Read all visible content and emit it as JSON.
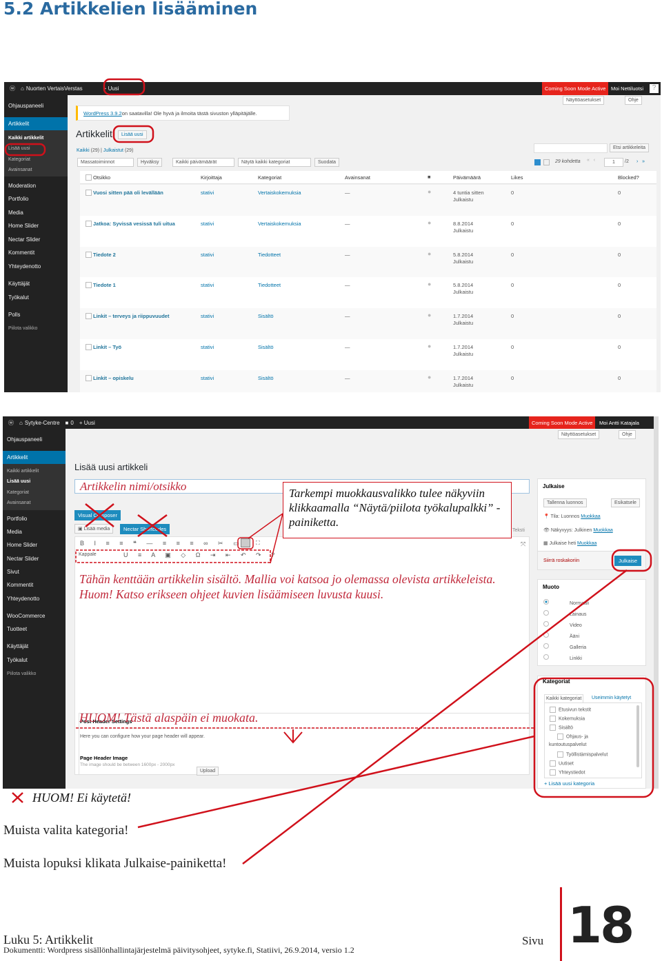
{
  "heading": "5.2 Artikkelien lisääminen",
  "shot1": {
    "adminbar": {
      "site": "Nuorten VertaisVerstas",
      "new": "Uusi",
      "coming_soon": "Coming Soon Mode Active",
      "greeting": "Moi Nettiluotsi",
      "help_icon": "?"
    },
    "screen_options": "Näyttöasetukset",
    "help": "Ohje",
    "sidebar": {
      "dashboard": "Ohjauspaneeli",
      "posts": "Artikkelit",
      "all_posts": "Kaikki artikkelit",
      "add_new": "Lisää uusi",
      "categories": "Kategoriat",
      "tags": "Avainsanat",
      "items": [
        "Moderation",
        "Portfolio",
        "Media",
        "Home Slider",
        "Nectar Slider",
        "Kommentit",
        "Yhteydenotto",
        "Käyttäjät",
        "Työkalut",
        "Polls",
        "Piilota valikko"
      ]
    },
    "notice_link": "WordPress 3.9.2",
    "notice_text": "on saatavilla! Ole hyvä ja ilmoita tästä sivuston ylläpitäjälle.",
    "page_title": "Artikkelit",
    "add_new_button": "Lisää uusi",
    "filters_all": "Kaikki",
    "filters_all_count": "(29)",
    "filters_published": "Julkaistut",
    "filters_published_count": "(29)",
    "bulk": "Massatoiminnot",
    "apply": "Hyväksy",
    "dates": "Kaikki päivämäärät",
    "cats": "Näytä kaikki kategoriat",
    "filter": "Suodata",
    "search_button": "Etsi artikkeleita",
    "items_count": "29 kohdetta",
    "page": "1",
    "pages": "/2",
    "columns": [
      "Otsikko",
      "Kirjoittaja",
      "Kategoriat",
      "Avainsanat",
      "Päivämäärä",
      "Likes",
      "Blocked?"
    ],
    "rows": [
      {
        "title": "Vuosi sitten pää oli levällään",
        "author": "stativi",
        "category": "Vertaiskokemuksia",
        "tags": "—",
        "date": "4 tuntia sitten",
        "status": "Julkaistu",
        "likes": "0",
        "blocked": "0"
      },
      {
        "title": "Jatkoa: Syvissä vesissä tuli uitua",
        "author": "stativi",
        "category": "Vertaiskokemuksia",
        "tags": "—",
        "date": "8.8.2014",
        "status": "Julkaistu",
        "likes": "0",
        "blocked": "0"
      },
      {
        "title": "Tiedote 2",
        "author": "stativi",
        "category": "Tiedotteet",
        "tags": "—",
        "date": "5.8.2014",
        "status": "Julkaistu",
        "likes": "0",
        "blocked": "0"
      },
      {
        "title": "Tiedote 1",
        "author": "stativi",
        "category": "Tiedotteet",
        "tags": "—",
        "date": "5.8.2014",
        "status": "Julkaistu",
        "likes": "0",
        "blocked": "0"
      },
      {
        "title": "Linkit – terveys ja riippuvuudet",
        "author": "stativi",
        "category": "Sisältö",
        "tags": "—",
        "date": "1.7.2014",
        "status": "Julkaistu",
        "likes": "0",
        "blocked": "0"
      },
      {
        "title": "Linkit – Työ",
        "author": "stativi",
        "category": "Sisältö",
        "tags": "—",
        "date": "1.7.2014",
        "status": "Julkaistu",
        "likes": "0",
        "blocked": "0"
      },
      {
        "title": "Linkit – opiskelu",
        "author": "stativi",
        "category": "Sisältö",
        "tags": "—",
        "date": "1.7.2014",
        "status": "Julkaistu",
        "likes": "0",
        "blocked": "0"
      }
    ]
  },
  "shot2": {
    "adminbar": {
      "site": "Sytyke-Centre",
      "comments": "0",
      "new": "Uusi",
      "coming_soon": "Coming Soon Mode Active",
      "greeting": "Moi Antti Katajala"
    },
    "screen_options": "Näyttöasetukset",
    "help": "Ohje",
    "sidebar": {
      "dashboard": "Ohjauspaneeli",
      "posts": "Artikkelit",
      "all_posts": "Kaikki artikkelit",
      "add_new": "Lisää uusi",
      "categories": "Kategoriat",
      "tags": "Avainsanat",
      "items": [
        "Portfolio",
        "Media",
        "Home Slider",
        "Nectar Slider",
        "Sivut",
        "Kommentit",
        "Yhteydenotto",
        "WooCommerce",
        "Tuotteet",
        "Käyttäjät",
        "Työkalut",
        "Piilota valikko"
      ]
    },
    "page_title": "Lisää uusi artikkeli",
    "title_placeholder": "Artikkelin nimi/otsikko",
    "visual_composer": "Visual Composer",
    "add_media": "Lisää media",
    "nectar": "Nectar Shortcodes",
    "text_tab": "Teksti",
    "format_select": "Kappale",
    "publish": {
      "title": "Julkaise",
      "save_draft": "Tallenna luonnos",
      "preview": "Esikatsele",
      "status": "Tila: Luonnos",
      "visibility": "Näkyvyys: Julkinen",
      "schedule": "Julkaise heti",
      "edit": "Muokkaa",
      "trash": "Siirrä roskakoriin",
      "publish_button": "Julkaise"
    },
    "format": {
      "title": "Muoto",
      "options": [
        "Normaali",
        "Lainaus",
        "Video",
        "Ääni",
        "Galleria",
        "Linkki"
      ],
      "selected": "Normaali"
    },
    "categories": {
      "title": "Kategoriat",
      "tab_all": "Kaikki kategoriat",
      "tab_popular": "Useimmin käytetyt",
      "items": [
        "Etusivun tekstit",
        "Kokemuksia",
        "Sisältö",
        "Ohjaus- ja",
        "kuntoutuspalvelut",
        "Työllistämispalvelut",
        "Uutiset",
        "Yhteystiedot"
      ],
      "add_new": "+ Lisää uusi kategoria"
    },
    "post_header": {
      "title": "Post Header Settings",
      "desc": "Here you can configure how your page header will appear.",
      "image_label": "Page Header Image",
      "image_desc": "The image should be between 1600px - 2000px",
      "upload": "Upload"
    }
  },
  "annotations": {
    "callout": "Tarkempi muokkausvalikko tulee näkyviin klikkaamalla “Näytä/piilota työkalupalkki” -painiketta.",
    "content_line1": "Tähän kenttään artikkelin sisältö. Mallia voi katsoa jo olemassa olevista artikkeleista.",
    "content_line2": "Huom! Katso erikseen ohjeet kuvien lisäämiseen luvusta kuusi.",
    "no_edit": "HUOM! Tästä alaspäin ei muokata.",
    "not_used": "HUOM! Ei käytetä!",
    "choose_category": "Muista valita kategoria!",
    "publish_reminder": "Muista lopuksi klikata Julkaise-painiketta!",
    "color": "#d0111b"
  },
  "footer": {
    "chapter": "Luku 5: Artikkelit",
    "document": "Dokumentti: Wordpress sisällönhallintajärjestelmä päivitysohjeet, sytyke.fi, Statiivi, 26.9.2014, versio 1.2",
    "page_label": "Sivu",
    "page_number": "18"
  }
}
